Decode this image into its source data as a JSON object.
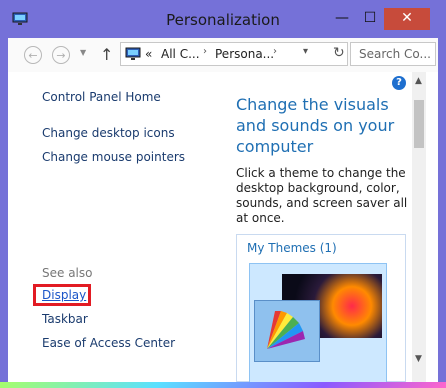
{
  "window": {
    "title": "Personalization"
  },
  "toolbar": {
    "crumbs": [
      "«",
      "All C...",
      "›",
      "Persona...",
      "›"
    ],
    "search_placeholder": "Search Co..."
  },
  "sidebar": {
    "home": "Control Panel Home",
    "desktop_icons": "Change desktop icons",
    "mouse_pointers": "Change mouse pointers",
    "see_also": "See also",
    "display": "Display",
    "taskbar": "Taskbar",
    "ease": "Ease of Access Center"
  },
  "main": {
    "heading": "Change the visuals and sounds on your computer",
    "description": "Click a theme to change the desktop background, color, sounds, and screen saver all at once.",
    "themes_label": "My Themes (1)"
  }
}
